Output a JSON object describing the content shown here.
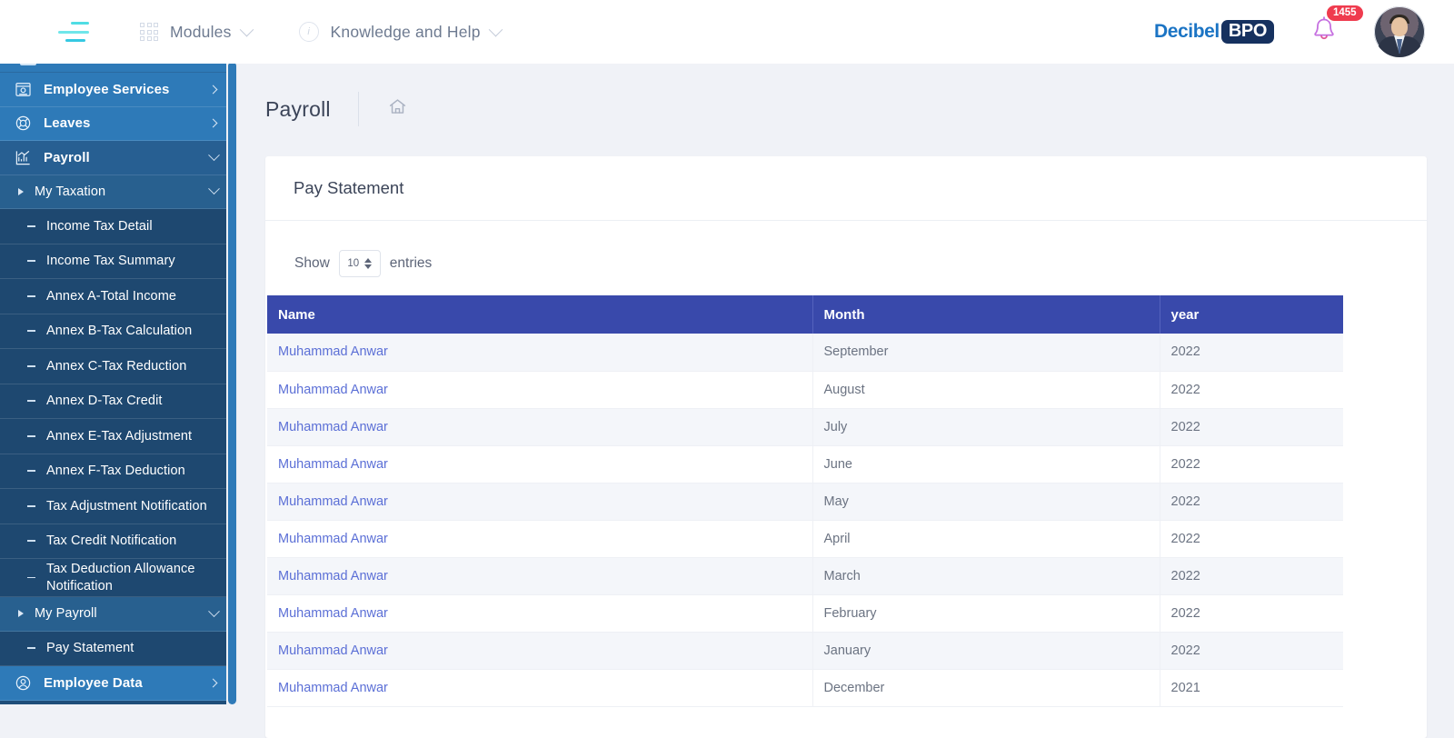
{
  "topbar": {
    "menu_icon": "hamburger-icon",
    "modules_label": "Modules",
    "knowledge_label": "Knowledge and Help",
    "logo_primary": "Decibel",
    "logo_badge": "BPO",
    "notification_count": "1455",
    "bell_icon": "bell-icon",
    "avatar_icon": "user-avatar"
  },
  "sidebar": {
    "items": [
      {
        "label": "Employee Services",
        "level": "top",
        "icon": "id-card-icon",
        "arrow": "right"
      },
      {
        "label": "Leaves",
        "level": "top",
        "icon": "lifebuoy-icon",
        "arrow": "right"
      },
      {
        "label": "Payroll",
        "level": "top-active",
        "icon": "chart-line-icon",
        "arrow": "down"
      },
      {
        "label": "My Taxation",
        "level": "sub",
        "icon": "triangle-icon",
        "arrow": "down"
      },
      {
        "label": "Income Tax Detail",
        "level": "leaf",
        "icon": "dash-icon",
        "arrow": "none"
      },
      {
        "label": "Income Tax Summary",
        "level": "leaf",
        "icon": "dash-icon",
        "arrow": "none"
      },
      {
        "label": "Annex A-Total Income",
        "level": "leaf",
        "icon": "dash-icon",
        "arrow": "none"
      },
      {
        "label": "Annex B-Tax Calculation",
        "level": "leaf",
        "icon": "dash-icon",
        "arrow": "none"
      },
      {
        "label": "Annex C-Tax Reduction",
        "level": "leaf",
        "icon": "dash-icon",
        "arrow": "none"
      },
      {
        "label": "Annex D-Tax Credit",
        "level": "leaf",
        "icon": "dash-icon",
        "arrow": "none"
      },
      {
        "label": "Annex E-Tax Adjustment",
        "level": "leaf",
        "icon": "dash-icon",
        "arrow": "none"
      },
      {
        "label": "Annex F-Tax Deduction",
        "level": "leaf",
        "icon": "dash-icon",
        "arrow": "none"
      },
      {
        "label": "Tax Adjustment Notification",
        "level": "leaf",
        "icon": "dash-icon",
        "arrow": "none"
      },
      {
        "label": "Tax Credit Notification",
        "level": "leaf",
        "icon": "dash-icon",
        "arrow": "none"
      },
      {
        "label": "Tax Deduction Allowance Notification",
        "level": "leaf-tall",
        "icon": "dash-icon",
        "arrow": "none"
      },
      {
        "label": "My Payroll",
        "level": "sub",
        "icon": "triangle-icon",
        "arrow": "down"
      },
      {
        "label": "Pay Statement",
        "level": "leaf",
        "icon": "dash-icon",
        "arrow": "none"
      },
      {
        "label": "Employee Data",
        "level": "top",
        "icon": "user-circle-icon",
        "arrow": "right"
      }
    ]
  },
  "page": {
    "title": "Payroll",
    "home_icon": "home-icon"
  },
  "card": {
    "title": "Pay Statement",
    "show_prefix": "Show",
    "entries_value": "10",
    "show_suffix": "entries",
    "columns": [
      "Name",
      "Month",
      "year"
    ],
    "rows": [
      {
        "name": "Muhammad Anwar",
        "month": "September",
        "year": "2022"
      },
      {
        "name": "Muhammad Anwar",
        "month": "August",
        "year": "2022"
      },
      {
        "name": "Muhammad Anwar",
        "month": "July",
        "year": "2022"
      },
      {
        "name": "Muhammad Anwar",
        "month": "June",
        "year": "2022"
      },
      {
        "name": "Muhammad Anwar",
        "month": "May",
        "year": "2022"
      },
      {
        "name": "Muhammad Anwar",
        "month": "April",
        "year": "2022"
      },
      {
        "name": "Muhammad Anwar",
        "month": "March",
        "year": "2022"
      },
      {
        "name": "Muhammad Anwar",
        "month": "February",
        "year": "2022"
      },
      {
        "name": "Muhammad Anwar",
        "month": "January",
        "year": "2022"
      },
      {
        "name": "Muhammad Anwar",
        "month": "December",
        "year": "2021"
      }
    ]
  },
  "colors": {
    "sidebar_base": "#1f4e79",
    "sidebar_top": "#2e7ab8",
    "table_header": "#3949ab",
    "link": "#5b6fd6",
    "badge": "#ef3b4e",
    "accent_cyan": "#3fd8e0"
  }
}
